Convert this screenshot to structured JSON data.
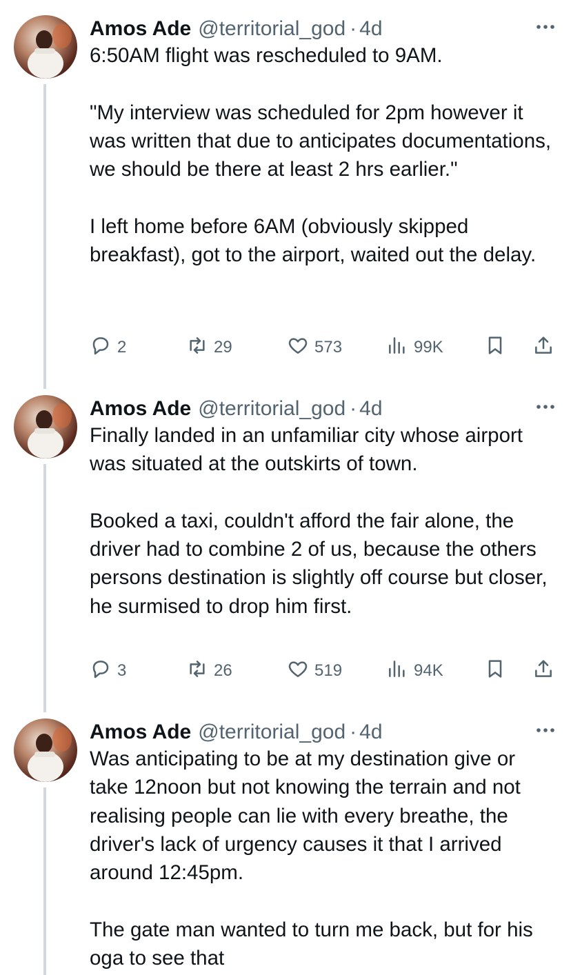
{
  "tweets": [
    {
      "name": "Amos Ade",
      "handle": "@territorial_god",
      "separator": "·",
      "time": "4d",
      "paragraphs": [
        "6:50AM flight was rescheduled to 9AM.",
        "\"My interview was scheduled for 2pm however it was written that due to anticipates documentations, we should be there at least 2 hrs earlier.\"",
        "I left home before 6AM (obviously skipped breakfast), got to the airport, waited out the delay."
      ],
      "replies": "2",
      "reposts": "29",
      "likes": "573",
      "views": "99K"
    },
    {
      "name": "Amos Ade",
      "handle": "@territorial_god",
      "separator": "·",
      "time": "4d",
      "paragraphs": [
        "Finally landed in an unfamiliar city whose airport was situated at the outskirts of town.",
        "Booked a taxi, couldn't afford the fair alone, the driver had to combine 2 of us, because the others persons destination is slightly off course but closer, he surmised to drop him first."
      ],
      "replies": "3",
      "reposts": "26",
      "likes": "519",
      "views": "94K"
    },
    {
      "name": "Amos Ade",
      "handle": "@territorial_god",
      "separator": "·",
      "time": "4d",
      "paragraphs": [
        "Was anticipating to be at my destination give or take 12noon but not knowing the terrain and not realising people can lie with every breathe, the driver's lack of urgency causes it that I arrived around 12:45pm.",
        "The gate man wanted to turn me back, but for his oga to see that"
      ]
    }
  ],
  "icons": {
    "more": "more-dots-icon",
    "reply": "reply-icon",
    "repost": "repost-icon",
    "like": "heart-icon",
    "views": "views-icon",
    "bookmark": "bookmark-icon",
    "share": "share-icon"
  },
  "colors": {
    "text": "#0f1419",
    "secondary": "#536471",
    "thread_line": "#cfd9de",
    "background": "#ffffff"
  }
}
